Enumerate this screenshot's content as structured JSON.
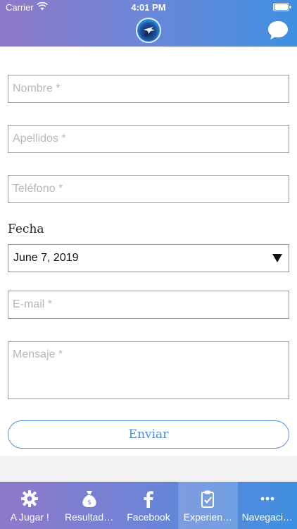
{
  "status_bar": {
    "carrier": "Carrier",
    "time": "4:01 PM"
  },
  "header": {
    "logo_icon": "app-logo",
    "chat_icon": "chat-bubble-icon"
  },
  "form": {
    "nombre_placeholder": "Nombre *",
    "apellidos_placeholder": "Apellidos *",
    "telefono_placeholder": "Teléfono *",
    "fecha_label": "Fecha",
    "fecha_value": "June 7, 2019",
    "email_placeholder": "E-mail *",
    "mensaje_placeholder": "Mensaje *",
    "submit_label": "Enviar"
  },
  "tabs": [
    {
      "label": "A Jugar !",
      "icon": "gear-icon",
      "active": false
    },
    {
      "label": "Resultad…",
      "icon": "money-bag-icon",
      "active": false
    },
    {
      "label": "Facebook",
      "icon": "facebook-icon",
      "active": false
    },
    {
      "label": "Experien…",
      "icon": "clipboard-check-icon",
      "active": true
    },
    {
      "label": "Navegaci…",
      "icon": "more-icon",
      "active": false
    }
  ],
  "colors": {
    "accent": "#4f8fe2",
    "header_start": "#8f78c9",
    "header_end": "#3f8fe0"
  }
}
